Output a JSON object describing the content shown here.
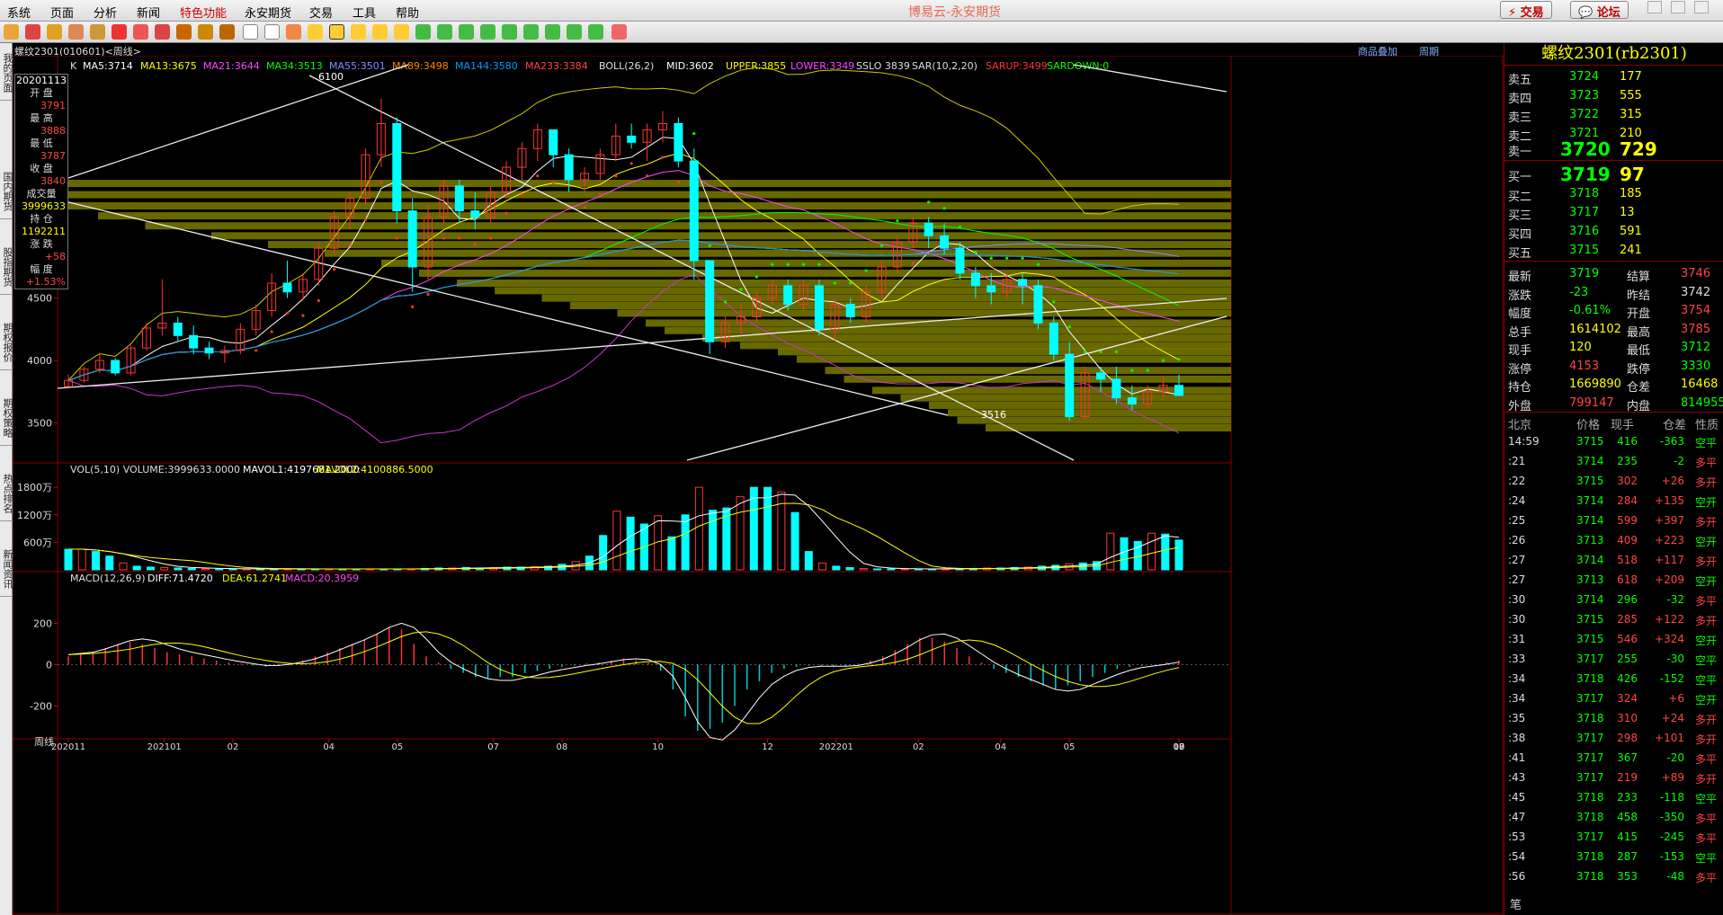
{
  "menu": {
    "items": [
      "系统",
      "页面",
      "分析",
      "新闻",
      "特色功能",
      "永安期货",
      "交易",
      "工具",
      "帮助"
    ],
    "app_title": "博易云-永安期货",
    "trade_button": "交易",
    "forum_button": "论坛"
  },
  "side_tabs": [
    "我的页面",
    "国内期货",
    "股指期货",
    "期权报价",
    "期权策略",
    "热点排名",
    "新闻资讯"
  ],
  "chart_header": {
    "title": "螺纹2301(010601)<周线>",
    "links": [
      "商品叠加",
      "周期"
    ]
  },
  "indicator_line": {
    "k": "K",
    "ma5": "MA5:3714",
    "ma13": "MA13:3675",
    "ma21": "MA21:3644",
    "ma34": "MA34:3513",
    "ma55": "MA55:3501",
    "ma89": "MA89:3498",
    "ma144": "MA144:3580",
    "ma233": "MA233:3384",
    "boll": "BOLL(26,2)",
    "mid": "MID:3602",
    "upper": "UPPER:3855",
    "lower": "LOWER:3349",
    "sslo": "SSLO 3839",
    "sar": "SAR(10,2,20)",
    "sarup": "SARUP:3499",
    "sardown": "SARDOWN:0"
  },
  "infobox": {
    "date": "20201113",
    "open_label": "开 盘",
    "open": "3791",
    "high_label": "最 高",
    "high": "3888",
    "low_label": "最 低",
    "low": "3787",
    "close_label": "收 盘",
    "close": "3840",
    "vol_label": "成交量",
    "vol": "3999633",
    "oi_label": "持 仓",
    "oi": "1192211",
    "chg_label": "涨 跌",
    "chg": "+58",
    "pct_label": "幅 度",
    "pct": "+1.53%"
  },
  "vol_header": {
    "vol": "VOL(5,10) VOLUME:3999633.0000",
    "mavol1": "MAVOL1:4197681.2000",
    "mavol2": "MAVOL2:4100886.5000"
  },
  "macd_header": {
    "macd": "MACD(12,26,9)",
    "diff": "DIFF:71.4720",
    "dea": "DEA:61.2741",
    "value": "MACD:20.3959"
  },
  "annotations": {
    "high_mark": "6100",
    "low_mark": "3516"
  },
  "x_axis_label": "周线",
  "x_ticks": [
    "202011",
    "202101",
    "02",
    "04",
    "05",
    "07",
    "08",
    "10",
    "12",
    "202201",
    "02",
    "04",
    "05",
    "07",
    "08",
    "10"
  ],
  "chart_data": [
    {
      "type": "candlestick",
      "title": "螺纹2301 周线",
      "y_ticks": [
        3500,
        4000,
        4500
      ],
      "ylim": [
        3200,
        6300
      ],
      "ohlc": [
        [
          3791,
          3888,
          3787,
          3840
        ],
        [
          3840,
          3950,
          3820,
          3930
        ],
        [
          3930,
          4060,
          3900,
          4000
        ],
        [
          4000,
          4020,
          3880,
          3900
        ],
        [
          3900,
          4120,
          3880,
          4100
        ],
        [
          4100,
          4300,
          4080,
          4260
        ],
        [
          4260,
          4650,
          4200,
          4300
        ],
        [
          4300,
          4350,
          4150,
          4200
        ],
        [
          4200,
          4280,
          4050,
          4100
        ],
        [
          4100,
          4150,
          4010,
          4060
        ],
        [
          4060,
          4120,
          3980,
          4080
        ],
        [
          4080,
          4300,
          4050,
          4250
        ],
        [
          4250,
          4450,
          4200,
          4400
        ],
        [
          4400,
          4700,
          4350,
          4620
        ],
        [
          4620,
          4800,
          4500,
          4550
        ],
        [
          4550,
          4700,
          4480,
          4650
        ],
        [
          4650,
          4950,
          4600,
          4900
        ],
        [
          4900,
          5200,
          4850,
          5150
        ],
        [
          5150,
          5350,
          5050,
          5300
        ],
        [
          5300,
          5700,
          5250,
          5650
        ],
        [
          5650,
          6100,
          5550,
          5900
        ],
        [
          5900,
          5950,
          5100,
          5200
        ],
        [
          5200,
          5300,
          4550,
          4750
        ],
        [
          4750,
          5250,
          4650,
          5150
        ],
        [
          5150,
          5450,
          5100,
          5400
        ],
        [
          5400,
          5450,
          5100,
          5200
        ],
        [
          5200,
          5350,
          5050,
          5150
        ],
        [
          5150,
          5400,
          5100,
          5350
        ],
        [
          5350,
          5600,
          5300,
          5550
        ],
        [
          5550,
          5750,
          5450,
          5700
        ],
        [
          5700,
          5900,
          5600,
          5850
        ],
        [
          5850,
          5850,
          5550,
          5650
        ],
        [
          5650,
          5700,
          5350,
          5450
        ],
        [
          5450,
          5550,
          5350,
          5500
        ],
        [
          5500,
          5700,
          5450,
          5650
        ],
        [
          5650,
          5900,
          5600,
          5800
        ],
        [
          5800,
          5900,
          5700,
          5750
        ],
        [
          5750,
          5900,
          5600,
          5850
        ],
        [
          5850,
          6000,
          5750,
          5900
        ],
        [
          5900,
          5950,
          5550,
          5600
        ],
        [
          5600,
          5700,
          4650,
          4800
        ],
        [
          4800,
          4800,
          4050,
          4150
        ],
        [
          4150,
          4350,
          4100,
          4300
        ],
        [
          4300,
          4450,
          4200,
          4350
        ],
        [
          4350,
          4550,
          4300,
          4500
        ],
        [
          4500,
          4650,
          4450,
          4600
        ],
        [
          4600,
          4650,
          4400,
          4450
        ],
        [
          4450,
          4650,
          4400,
          4600
        ],
        [
          4600,
          4650,
          4200,
          4250
        ],
        [
          4250,
          4500,
          4150,
          4450
        ],
        [
          4450,
          4500,
          4300,
          4350
        ],
        [
          4350,
          4600,
          4300,
          4550
        ],
        [
          4550,
          4800,
          4500,
          4750
        ],
        [
          4750,
          5000,
          4700,
          4950
        ],
        [
          4950,
          5150,
          4900,
          5100
        ],
        [
          5100,
          5150,
          4900,
          5000
        ],
        [
          5000,
          5100,
          4850,
          4900
        ],
        [
          4900,
          4950,
          4650,
          4700
        ],
        [
          4700,
          4750,
          4500,
          4600
        ],
        [
          4600,
          4700,
          4450,
          4550
        ],
        [
          4550,
          4700,
          4500,
          4650
        ],
        [
          4650,
          4700,
          4450,
          4600
        ],
        [
          4600,
          4650,
          4250,
          4300
        ],
        [
          4300,
          4350,
          4000,
          4050
        ],
        [
          4050,
          4150,
          3516,
          3550
        ],
        [
          3550,
          3950,
          3520,
          3900
        ],
        [
          3900,
          3950,
          3750,
          3850
        ],
        [
          3850,
          3950,
          3650,
          3700
        ],
        [
          3700,
          3800,
          3600,
          3650
        ],
        [
          3650,
          3800,
          3620,
          3750
        ],
        [
          3750,
          3880,
          3700,
          3800
        ],
        [
          3800,
          3888,
          3720,
          3719
        ]
      ]
    },
    {
      "type": "bar",
      "title": "VOL(5,10)",
      "y_ticks_label": [
        "600万",
        "1200万",
        "1800万"
      ],
      "y_ticks": [
        600,
        1200,
        1800
      ],
      "ylim": [
        0,
        2000
      ],
      "values": [
        450,
        450,
        400,
        300,
        150,
        80,
        60,
        50,
        40,
        30,
        25,
        20,
        20,
        20,
        20,
        20,
        20,
        20,
        20,
        20,
        20,
        20,
        20,
        20,
        20,
        20,
        30,
        40,
        40,
        50,
        40,
        50,
        60,
        60,
        70,
        80,
        120,
        180,
        300,
        750,
        1280,
        1150,
        1000,
        1180,
        720,
        1200,
        1800,
        1300,
        1350,
        1600,
        1800,
        1800,
        1700,
        1250,
        400,
        150,
        80,
        50,
        30,
        20,
        20,
        20,
        20,
        20,
        25,
        30,
        30,
        40,
        40,
        50,
        60,
        80,
        100,
        130,
        150,
        180,
        800,
        700,
        620,
        800,
        780,
        650
      ]
    },
    {
      "type": "bar",
      "title": "MACD(12,26,9)",
      "y_ticks": [
        -200,
        0,
        200
      ],
      "ylim": [
        -350,
        380
      ],
      "values": [
        40,
        50,
        60,
        80,
        100,
        110,
        100,
        80,
        60,
        50,
        40,
        30,
        20,
        10,
        5,
        -5,
        -10,
        5,
        10,
        20,
        40,
        60,
        80,
        100,
        120,
        150,
        180,
        170,
        100,
        40,
        10,
        -20,
        -40,
        -60,
        -70,
        -60,
        -60,
        -40,
        -30,
        -20,
        -10,
        -5,
        5,
        10,
        20,
        30,
        20,
        10,
        -30,
        -120,
        -250,
        -320,
        -310,
        -280,
        -200,
        -120,
        -80,
        -40,
        -20,
        -10,
        -5,
        -5,
        -10,
        -5,
        5,
        20,
        40,
        70,
        100,
        130,
        130,
        110,
        80,
        40,
        10,
        -20,
        -40,
        -60,
        -80,
        -100,
        -120,
        -100,
        -80,
        -60,
        -40,
        -20,
        -10,
        -5,
        0,
        10,
        20
      ]
    }
  ],
  "quote": {
    "title": "螺纹2301(rb2301)",
    "asks": [
      {
        "label": "卖五",
        "price": "3724",
        "vol": "177"
      },
      {
        "label": "卖四",
        "price": "3723",
        "vol": "555"
      },
      {
        "label": "卖三",
        "price": "3722",
        "vol": "315"
      },
      {
        "label": "卖二",
        "price": "3721",
        "vol": "210"
      },
      {
        "label": "卖一",
        "price": "3720",
        "vol": "729"
      }
    ],
    "bids": [
      {
        "label": "买一",
        "price": "3719",
        "vol": "97"
      },
      {
        "label": "买二",
        "price": "3718",
        "vol": "185"
      },
      {
        "label": "买三",
        "price": "3717",
        "vol": "13"
      },
      {
        "label": "买四",
        "price": "3716",
        "vol": "591"
      },
      {
        "label": "买五",
        "price": "3715",
        "vol": "241"
      }
    ],
    "stats": [
      {
        "l1": "最新",
        "v1": "3719",
        "l2": "结算",
        "v2": "3746"
      },
      {
        "l1": "涨跌",
        "v1": "-23",
        "l2": "昨结",
        "v2": "3742"
      },
      {
        "l1": "幅度",
        "v1": "-0.61%",
        "l2": "开盘",
        "v2": "3754"
      },
      {
        "l1": "总手",
        "v1": "1614102",
        "l2": "最高",
        "v2": "3785"
      },
      {
        "l1": "现手",
        "v1": "120",
        "l2": "最低",
        "v2": "3712"
      },
      {
        "l1": "涨停",
        "v1": "4153",
        "l2": "跌停",
        "v2": "3330"
      },
      {
        "l1": "持仓",
        "v1": "1669890",
        "l2": "仓差",
        "v2": "16468"
      },
      {
        "l1": "外盘",
        "v1": "799147",
        "l2": "内盘",
        "v2": "814955"
      }
    ],
    "tick_header": [
      "北京",
      "价格",
      "现手",
      "仓差",
      "性质"
    ],
    "ticks": [
      [
        "14:59",
        "3715",
        "416",
        "-363",
        "空平"
      ],
      [
        ":21",
        "3714",
        "235",
        "-2",
        "多平"
      ],
      [
        ":22",
        "3715",
        "302",
        "+26",
        "多开"
      ],
      [
        ":24",
        "3714",
        "284",
        "+135",
        "空开"
      ],
      [
        ":25",
        "3714",
        "599",
        "+397",
        "多开"
      ],
      [
        ":26",
        "3713",
        "409",
        "+223",
        "空开"
      ],
      [
        ":27",
        "3714",
        "518",
        "+117",
        "多开"
      ],
      [
        ":27",
        "3713",
        "618",
        "+209",
        "空开"
      ],
      [
        ":30",
        "3714",
        "296",
        "-32",
        "多平"
      ],
      [
        ":30",
        "3715",
        "285",
        "+122",
        "多开"
      ],
      [
        ":31",
        "3715",
        "546",
        "+324",
        "空开"
      ],
      [
        ":33",
        "3717",
        "255",
        "-30",
        "空平"
      ],
      [
        ":34",
        "3718",
        "426",
        "-152",
        "空平"
      ],
      [
        ":34",
        "3717",
        "324",
        "+6",
        "空开"
      ],
      [
        ":35",
        "3718",
        "310",
        "+24",
        "多开"
      ],
      [
        ":38",
        "3717",
        "298",
        "+101",
        "多开"
      ],
      [
        ":41",
        "3717",
        "367",
        "-20",
        "多平"
      ],
      [
        ":43",
        "3717",
        "219",
        "+89",
        "多开"
      ],
      [
        ":45",
        "3718",
        "233",
        "-118",
        "空平"
      ],
      [
        ":47",
        "3718",
        "458",
        "-350",
        "多平"
      ],
      [
        ":53",
        "3717",
        "415",
        "-245",
        "多平"
      ],
      [
        ":54",
        "3718",
        "287",
        "-153",
        "空平"
      ],
      [
        ":56",
        "3718",
        "353",
        "-48",
        "多平"
      ]
    ],
    "footer": "笔"
  }
}
